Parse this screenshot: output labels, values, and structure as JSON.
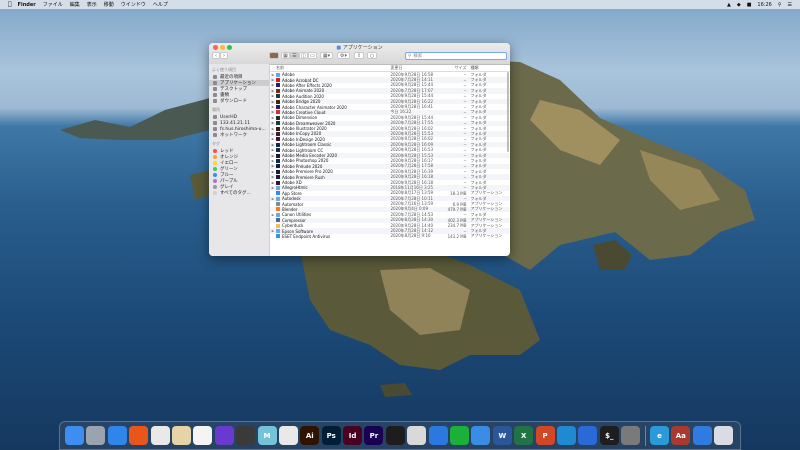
{
  "menubar": {
    "app_name": "Finder",
    "items": [
      "ファイル",
      "編集",
      "表示",
      "移動",
      "ウインドウ",
      "ヘルプ"
    ],
    "time": "16:26"
  },
  "window": {
    "title": "アプリケーション",
    "search_placeholder": "検索",
    "colors": {
      "close": "#ff5f57",
      "minimize": "#febc2e",
      "zoom": "#28c840",
      "accent": "#3b82f6"
    }
  },
  "sidebar": {
    "sections": [
      {
        "header": "よく使う項目",
        "items": [
          {
            "label": "最近の項目",
            "icon": "clock-icon"
          },
          {
            "label": "アプリケーション",
            "icon": "apps-icon",
            "selected": true
          },
          {
            "label": "デスクトップ",
            "icon": "desktop-icon"
          },
          {
            "label": "書類",
            "icon": "document-icon"
          },
          {
            "label": "ダウンロード",
            "icon": "download-icon"
          }
        ]
      },
      {
        "header": "場所",
        "items": [
          {
            "label": "UserHD",
            "icon": "disk-icon"
          },
          {
            "label": "133.41.21.11",
            "icon": "server-icon"
          },
          {
            "label": "fs.hus.hiroshima-u...",
            "icon": "server-icon"
          },
          {
            "label": "ネットワーク",
            "icon": "network-icon"
          }
        ]
      },
      {
        "header": "タグ",
        "tags": [
          {
            "label": "レッド",
            "color": "#ff4a4a"
          },
          {
            "label": "オレンジ",
            "color": "#ff9f2e"
          },
          {
            "label": "イエロー",
            "color": "#ffd426"
          },
          {
            "label": "グリーン",
            "color": "#3bd15a"
          },
          {
            "label": "ブルー",
            "color": "#3a8bff"
          },
          {
            "label": "パープル",
            "color": "#b86be0"
          },
          {
            "label": "グレイ",
            "color": "#9a9a9e"
          },
          {
            "label": "すべてのタグ...",
            "color": "#d0d0d4"
          }
        ]
      }
    ]
  },
  "columns": {
    "name": "名前",
    "date": "変更日",
    "size": "サイズ",
    "kind": "種類"
  },
  "files": [
    {
      "name": "Adobe",
      "date": "2020年9月28日 16:58",
      "size": "--",
      "kind": "フォルダ",
      "color": "#6da6e8",
      "folder": true
    },
    {
      "name": "Adobe Acrobat DC",
      "date": "2020年7月28日 14:11",
      "size": "--",
      "kind": "フォルダ",
      "color": "#cc1f1f",
      "folder": true
    },
    {
      "name": "Adobe After Effects 2020",
      "date": "2020年9月28日 15:44",
      "size": "--",
      "kind": "フォルダ",
      "color": "#2a1b5e",
      "folder": true
    },
    {
      "name": "Adobe Animate 2020",
      "date": "2020年7月28日 17:07",
      "size": "--",
      "kind": "フォルダ",
      "color": "#7a2a12",
      "folder": true
    },
    {
      "name": "Adobe Audition 2020",
      "date": "2020年9月28日 15:44",
      "size": "--",
      "kind": "フォルダ",
      "color": "#1f3b34",
      "folder": true
    },
    {
      "name": "Adobe Bridge 2020",
      "date": "2020年9月28日 16:22",
      "size": "--",
      "kind": "フォルダ",
      "color": "#3a2a10",
      "folder": true
    },
    {
      "name": "Adobe Character Animator 2020",
      "date": "2020年9月28日 16:41",
      "size": "--",
      "kind": "フォルダ",
      "color": "#2a1b5e",
      "folder": true
    },
    {
      "name": "Adobe Creative Cloud",
      "date": "今日 16:22",
      "size": "--",
      "kind": "フォルダ",
      "color": "#d6302c",
      "folder": true
    },
    {
      "name": "Adobe Dimension",
      "date": "2020年9月28日 15:44",
      "size": "--",
      "kind": "フォルダ",
      "color": "#1f2f2e",
      "folder": true
    },
    {
      "name": "Adobe Dreamweaver 2020",
      "date": "2020年7月28日 17:55",
      "size": "--",
      "kind": "フォルダ",
      "color": "#1f3b2e",
      "folder": true
    },
    {
      "name": "Adobe Illustrator 2020",
      "date": "2020年9月28日 16:02",
      "size": "--",
      "kind": "フォルダ",
      "color": "#3a1d0a",
      "folder": true
    },
    {
      "name": "Adobe InCopy 2020",
      "date": "2020年9月28日 15:53",
      "size": "--",
      "kind": "フォルダ",
      "color": "#3b1a2e",
      "folder": true
    },
    {
      "name": "Adobe InDesign 2020",
      "date": "2020年9月28日 16:02",
      "size": "--",
      "kind": "フォルダ",
      "color": "#4a0f2a",
      "folder": true
    },
    {
      "name": "Adobe Lightroom Classic",
      "date": "2020年9月28日 16:09",
      "size": "--",
      "kind": "フォルダ",
      "color": "#0f2a4a",
      "folder": true
    },
    {
      "name": "Adobe Lightroom CC",
      "date": "2020年9月28日 16:53",
      "size": "--",
      "kind": "フォルダ",
      "color": "#0f2a4a",
      "folder": true
    },
    {
      "name": "Adobe Media Encoder 2020",
      "date": "2020年9月28日 15:53",
      "size": "--",
      "kind": "フォルダ",
      "color": "#1a1a3a",
      "folder": true
    },
    {
      "name": "Adobe Photoshop 2020",
      "date": "2020年9月28日 16:17",
      "size": "--",
      "kind": "フォルダ",
      "color": "#0a2a4a",
      "folder": true
    },
    {
      "name": "Adobe Prelude 2020",
      "date": "2020年7月28日 17:58",
      "size": "--",
      "kind": "フォルダ",
      "color": "#1a1a3a",
      "folder": true
    },
    {
      "name": "Adobe Premiere Pro 2020",
      "date": "2020年9月28日 16:39",
      "size": "--",
      "kind": "フォルダ",
      "color": "#1a1a3a",
      "folder": true
    },
    {
      "name": "Adobe Premiere Rush",
      "date": "2020年9月28日 16:18",
      "size": "--",
      "kind": "フォルダ",
      "color": "#1a1a3a",
      "folder": true
    },
    {
      "name": "Adobe XD",
      "date": "2020年9月28日 16:18",
      "size": "--",
      "kind": "フォルダ",
      "color": "#3a0f2e",
      "folder": true
    },
    {
      "name": "AllegroHtmlc",
      "date": "2018年11月16日 3:25",
      "size": "--",
      "kind": "フォルダ",
      "color": "#6da6e8",
      "folder": true
    },
    {
      "name": "App Store",
      "date": "2020年8月17日 13:59",
      "size": "18.3 MB",
      "kind": "アプリケーション",
      "color": "#2a8bf2",
      "folder": false
    },
    {
      "name": "Autodesk",
      "date": "2020年7月28日 10:11",
      "size": "--",
      "kind": "フォルダ",
      "color": "#6da6e8",
      "folder": true
    },
    {
      "name": "Automator",
      "date": "2020年7月16日 13:59",
      "size": "6.9 MB",
      "kind": "アプリケーション",
      "color": "#8a8a8a",
      "folder": false
    },
    {
      "name": "Blender",
      "date": "2020年9月4日 0:09",
      "size": "479.7 MB",
      "kind": "アプリケーション",
      "color": "#f07a1c",
      "folder": false
    },
    {
      "name": "Canon Utilities",
      "date": "2020年7月28日 14:53",
      "size": "--",
      "kind": "フォルダ",
      "color": "#6da6e8",
      "folder": true
    },
    {
      "name": "Compressor",
      "date": "2020年8月28日 14:30",
      "size": "402.3 MB",
      "kind": "アプリケーション",
      "color": "#4a6a8a",
      "folder": false
    },
    {
      "name": "Cyberduck",
      "date": "2020年9月28日 14:40",
      "size": "234.7 MB",
      "kind": "アプリケーション",
      "color": "#e8c24a",
      "folder": false
    },
    {
      "name": "Epson Software",
      "date": "2020年7月28日 14:12",
      "size": "--",
      "kind": "フォルダ",
      "color": "#6da6e8",
      "folder": true
    },
    {
      "name": "ESET Endpoint Antivirus",
      "date": "2020年8月28日 9:16",
      "size": "143.2 MB",
      "kind": "アプリケーション",
      "color": "#2a9ad2",
      "folder": false
    }
  ],
  "dock": [
    {
      "name": "finder-icon",
      "label": "",
      "bg": "#3d8ef0"
    },
    {
      "name": "launchpad-icon",
      "label": "",
      "bg": "#9aa4b0"
    },
    {
      "name": "safari-icon",
      "label": "",
      "bg": "#2f86e8"
    },
    {
      "name": "firefox-icon",
      "label": "",
      "bg": "#e8561c"
    },
    {
      "name": "chrome-icon",
      "label": "",
      "bg": "#e9e9e9"
    },
    {
      "name": "pencil-app-icon",
      "label": "",
      "bg": "#e6d4a8"
    },
    {
      "name": "photos-icon",
      "label": "",
      "bg": "#f4f4f4"
    },
    {
      "name": "imovie-icon",
      "label": "",
      "bg": "#6a3ad0"
    },
    {
      "name": "final-cut-icon",
      "label": "",
      "bg": "#3a3a3a"
    },
    {
      "name": "app-m-icon",
      "label": "M",
      "bg": "#74c3d8"
    },
    {
      "name": "acrobat-icon",
      "label": "",
      "bg": "#e9e9e9"
    },
    {
      "name": "illustrator-icon",
      "label": "Ai",
      "bg": "#2e1300"
    },
    {
      "name": "photoshop-icon",
      "label": "Ps",
      "bg": "#001e36"
    },
    {
      "name": "indesign-icon",
      "label": "Id",
      "bg": "#49021f"
    },
    {
      "name": "premiere-icon",
      "label": "Pr",
      "bg": "#1a0055"
    },
    {
      "name": "clapper-icon",
      "label": "",
      "bg": "#1d1d1d"
    },
    {
      "name": "preview-icon",
      "label": "",
      "bg": "#d9d9d9"
    },
    {
      "name": "keynote-icon",
      "label": "",
      "bg": "#2a78e0"
    },
    {
      "name": "numbers-icon",
      "label": "",
      "bg": "#1bb03a"
    },
    {
      "name": "keynote-stand-icon",
      "label": "",
      "bg": "#3a8ce6"
    },
    {
      "name": "word-icon",
      "label": "W",
      "bg": "#2b579a"
    },
    {
      "name": "excel-icon",
      "label": "X",
      "bg": "#217346"
    },
    {
      "name": "powerpoint-icon",
      "label": "P",
      "bg": "#d24726"
    },
    {
      "name": "vscode-icon",
      "label": "",
      "bg": "#1f8ad2"
    },
    {
      "name": "xcode-icon",
      "label": "",
      "bg": "#2a6ad8"
    },
    {
      "name": "terminal-icon",
      "label": "$_",
      "bg": "#1e1e1e"
    },
    {
      "name": "system-preferences-icon",
      "label": "",
      "bg": "#7a7a7a"
    },
    {
      "name": "edge-icon",
      "label": "e",
      "bg": "#2a9ad8"
    },
    {
      "name": "dictionary-icon",
      "label": "Aa",
      "bg": "#a83a30"
    },
    {
      "name": "network-globe-icon",
      "label": "",
      "bg": "#2f7be0"
    },
    {
      "name": "trash-icon",
      "label": "",
      "bg": "#d9dde3"
    }
  ]
}
